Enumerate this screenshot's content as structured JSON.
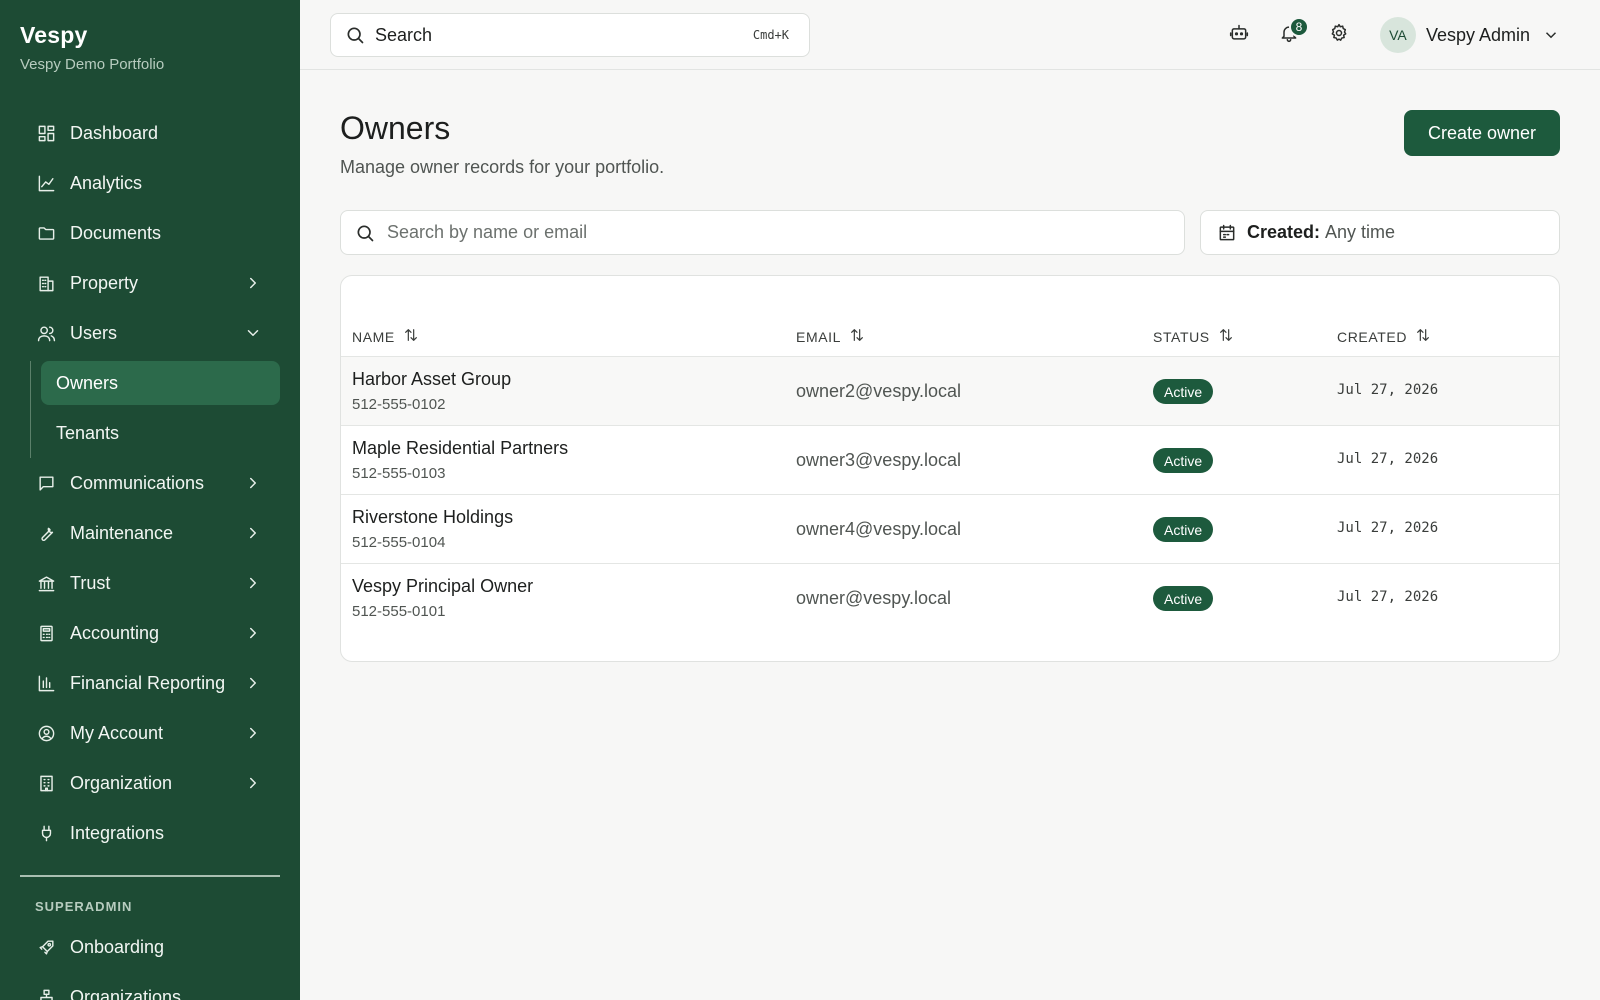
{
  "brand": {
    "title": "Vespy",
    "subtitle": "Vespy Demo Portfolio"
  },
  "sidebar": {
    "items": [
      {
        "label": "Dashboard",
        "icon": "dashboard-icon"
      },
      {
        "label": "Analytics",
        "icon": "chart-line-icon"
      },
      {
        "label": "Documents",
        "icon": "folder-icon"
      },
      {
        "label": "Property",
        "icon": "building-icon",
        "expandable": true
      },
      {
        "label": "Users",
        "icon": "users-icon",
        "expanded": true
      }
    ],
    "users_children": [
      {
        "label": "Owners",
        "active": true
      },
      {
        "label": "Tenants"
      }
    ],
    "items_after": [
      {
        "label": "Communications",
        "icon": "message-icon"
      },
      {
        "label": "Maintenance",
        "icon": "wrench-icon"
      },
      {
        "label": "Trust",
        "icon": "bank-icon"
      },
      {
        "label": "Accounting",
        "icon": "calculator-icon"
      },
      {
        "label": "Financial Reporting",
        "icon": "bar-chart-icon"
      },
      {
        "label": "My Account",
        "icon": "user-circle-icon"
      },
      {
        "label": "Organization",
        "icon": "office-icon"
      },
      {
        "label": "Integrations",
        "icon": "plug-icon"
      }
    ],
    "section_label": "SUPERADMIN",
    "superadmin_items": [
      {
        "label": "Onboarding",
        "icon": "rocket-icon"
      },
      {
        "label": "Organizations",
        "icon": "org-tree-icon"
      }
    ]
  },
  "topbar": {
    "search_placeholder": "Search",
    "shortcut": "Cmd+K",
    "notification_count": "8",
    "user_initials": "VA",
    "user_name": "Vespy Admin"
  },
  "main": {
    "title": "Owners",
    "subtitle": "Manage owner records for your portfolio.",
    "create_button": "Create owner",
    "filter_placeholder": "Search by name or email",
    "date_filter_label": "Created:",
    "date_filter_value": "Any time"
  },
  "table": {
    "columns": [
      "NAME",
      "EMAIL",
      "STATUS",
      "CREATED"
    ],
    "rows": [
      {
        "name": "Harbor Asset Group",
        "phone": "512-555-0102",
        "email": "owner2@vespy.local",
        "status": "Active",
        "created": "Jul 27, 2026"
      },
      {
        "name": "Maple Residential Partners",
        "phone": "512-555-0103",
        "email": "owner3@vespy.local",
        "status": "Active",
        "created": "Jul 27, 2026"
      },
      {
        "name": "Riverstone Holdings",
        "phone": "512-555-0104",
        "email": "owner4@vespy.local",
        "status": "Active",
        "created": "Jul 27, 2026"
      },
      {
        "name": "Vespy Principal Owner",
        "phone": "512-555-0101",
        "email": "owner@vespy.local",
        "status": "Active",
        "created": "Jul 27, 2026"
      }
    ]
  },
  "colors": {
    "sidebar_bg": "#1d4b34",
    "accent": "#1d5a3d",
    "active_item": "#2c6a4b"
  }
}
